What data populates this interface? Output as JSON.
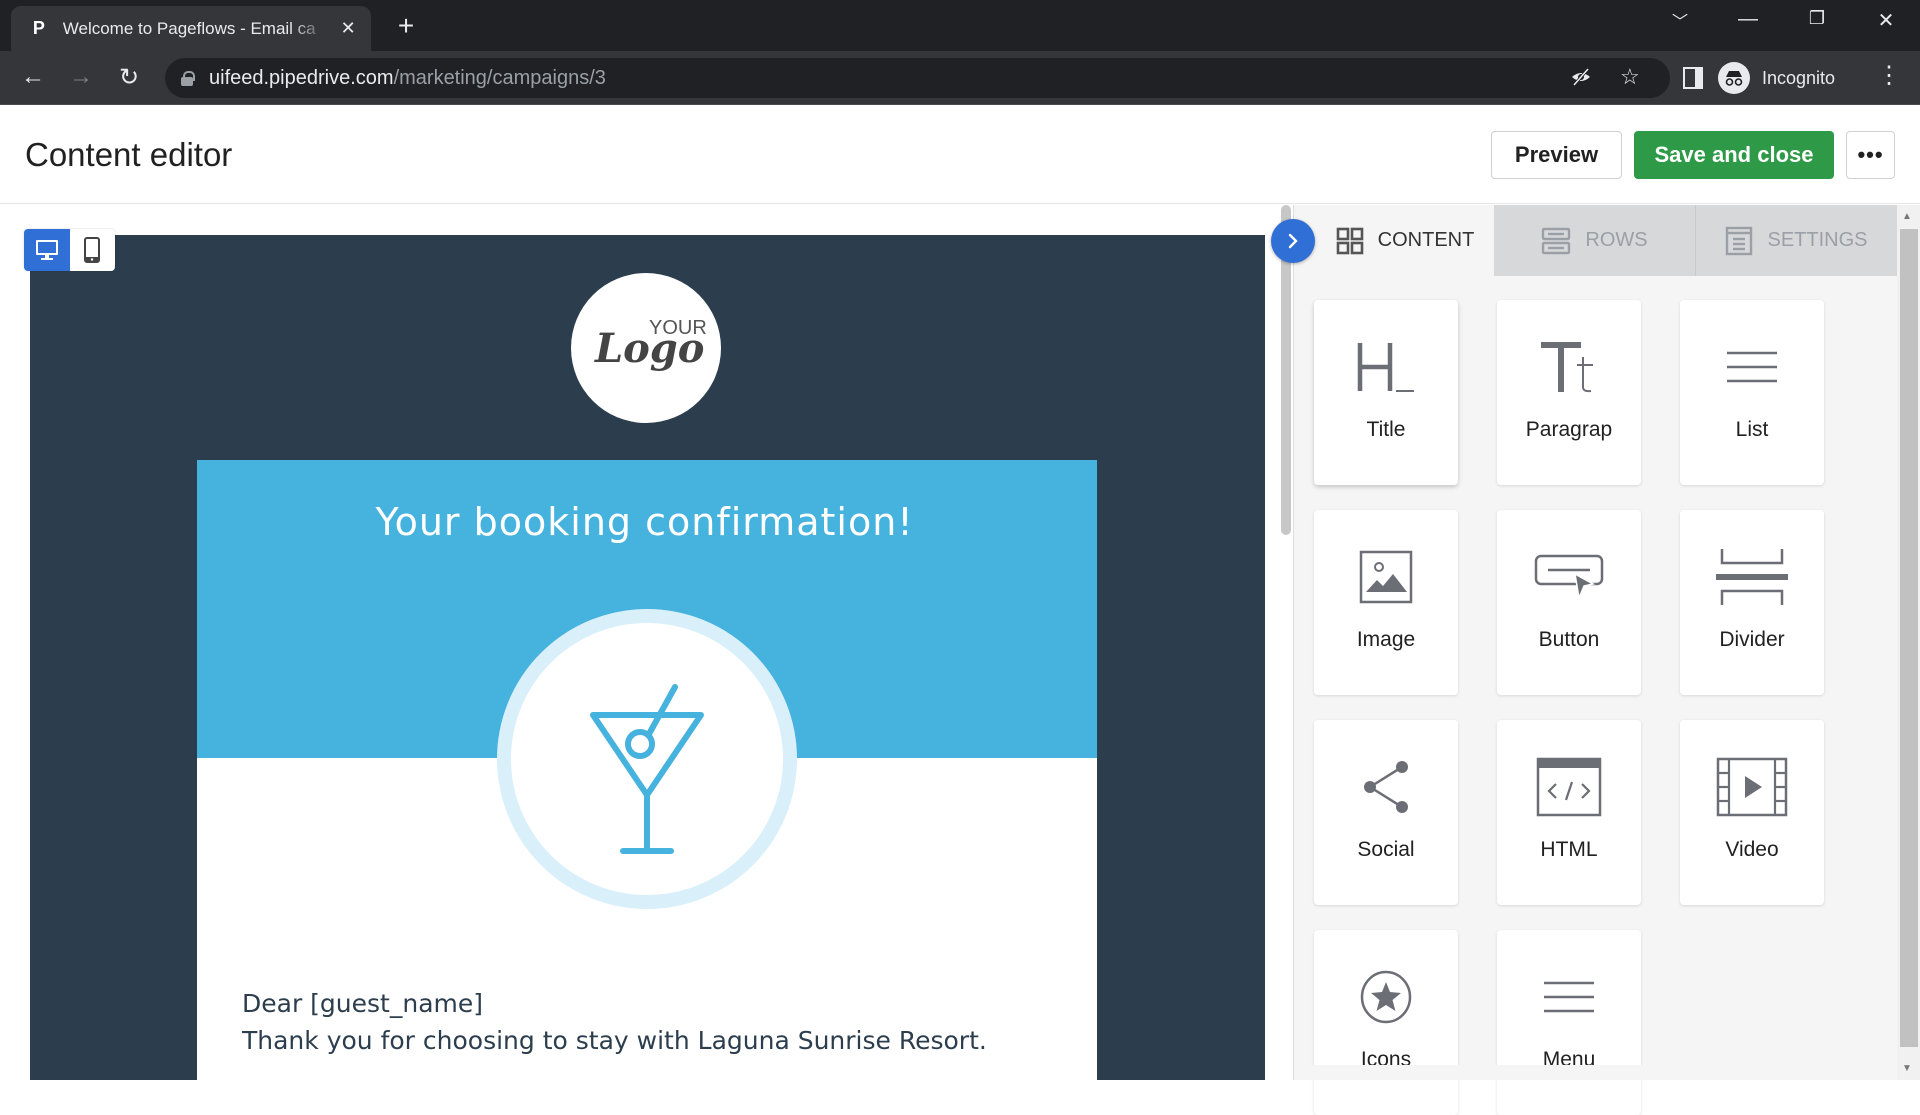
{
  "browser": {
    "tab_title": "Welcome to Pageflows - Email ca",
    "tab_favicon": "P",
    "url_host": "uifeed.pipedrive.com",
    "url_path": "/marketing/campaigns/3",
    "profile_label": "Incognito"
  },
  "header": {
    "title": "Content editor",
    "preview_label": "Preview",
    "save_label": "Save and close",
    "more_label": "•••"
  },
  "email": {
    "logo_small": "YOUR",
    "logo_script": "Logo",
    "hero_title": "Your booking confirmation!",
    "greeting": "Dear [guest_name]",
    "body_line": "Thank you for choosing to stay with Laguna Sunrise Resort.",
    "colors": {
      "background": "#2c3e4e",
      "hero": "#46b2de",
      "ring": "#d9f0fa"
    }
  },
  "panel": {
    "tabs": [
      {
        "label": "CONTENT",
        "icon": "grid-icon",
        "active": true
      },
      {
        "label": "ROWS",
        "icon": "rows-icon",
        "active": false
      },
      {
        "label": "SETTINGS",
        "icon": "settings-doc-icon",
        "active": false
      }
    ],
    "blocks": [
      {
        "label": "Title",
        "icon": "heading-icon"
      },
      {
        "label": "Paragrap",
        "icon": "paragraph-icon"
      },
      {
        "label": "List",
        "icon": "list-icon"
      },
      {
        "label": "Image",
        "icon": "image-icon"
      },
      {
        "label": "Button",
        "icon": "button-icon"
      },
      {
        "label": "Divider",
        "icon": "divider-icon"
      },
      {
        "label": "Social",
        "icon": "share-icon"
      },
      {
        "label": "HTML",
        "icon": "code-icon"
      },
      {
        "label": "Video",
        "icon": "video-icon"
      },
      {
        "label": "Icons",
        "icon": "star-icon"
      },
      {
        "label": "Menu",
        "icon": "menu-icon"
      }
    ]
  },
  "colors": {
    "accent": "#2f6fd6",
    "save": "#2e9a47"
  }
}
